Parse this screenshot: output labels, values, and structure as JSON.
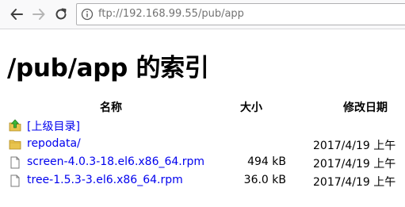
{
  "browser": {
    "url": "ftp://192.168.99.55/pub/app"
  },
  "page": {
    "title": "/pub/app 的索引"
  },
  "table": {
    "headers": {
      "name": "名称",
      "size": "大小",
      "modified": "修改日期"
    },
    "rows": [
      {
        "name": "[上级目录]",
        "size": "",
        "date": "",
        "icon": "up-folder-icon"
      },
      {
        "name": "repodata/",
        "size": "",
        "date": "2017/4/19 上午",
        "icon": "folder-icon"
      },
      {
        "name": "screen-4.0.3-18.el6.x86_64.rpm",
        "size": "494 kB",
        "date": "2017/4/19 上午",
        "icon": "file-icon"
      },
      {
        "name": "tree-1.5.3-3.el6.x86_64.rpm",
        "size": "36.0 kB",
        "date": "2017/4/19 上午",
        "icon": "file-icon"
      }
    ]
  }
}
